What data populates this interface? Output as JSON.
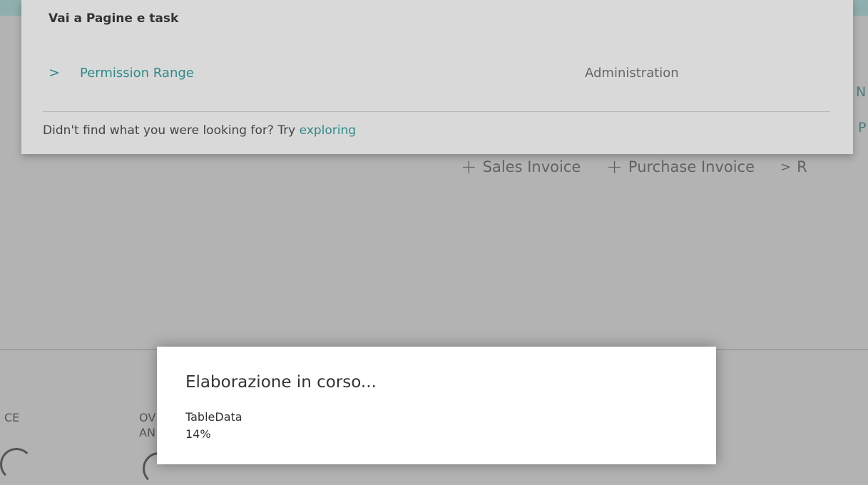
{
  "search": {
    "header": "Vai a Pagine e task",
    "results": [
      {
        "name": "Permission Range",
        "category": "Administration",
        "icon": "chevron-right-icon"
      }
    ],
    "footer_prefix": "Didn't find what you were looking for? Try ",
    "footer_link": "exploring"
  },
  "background": {
    "right_letters": [
      "N",
      "P",
      "R"
    ],
    "actions": [
      {
        "label": "Sales Invoice",
        "icon": "plus-icon"
      },
      {
        "label": "Purchase Invoice",
        "icon": "plus-icon"
      }
    ],
    "action_chevron": "chevron-right-icon",
    "lower_labels": [
      "CE",
      "OV",
      "AN"
    ]
  },
  "dialog": {
    "title": "Elaborazione in corso...",
    "item": "TableData",
    "percent": "14%",
    "progress": 0.14
  },
  "colors": {
    "accent": "#2f8a8a",
    "overlay_bg": "#b3b3b3",
    "panel_bg": "#d9d9d9"
  }
}
